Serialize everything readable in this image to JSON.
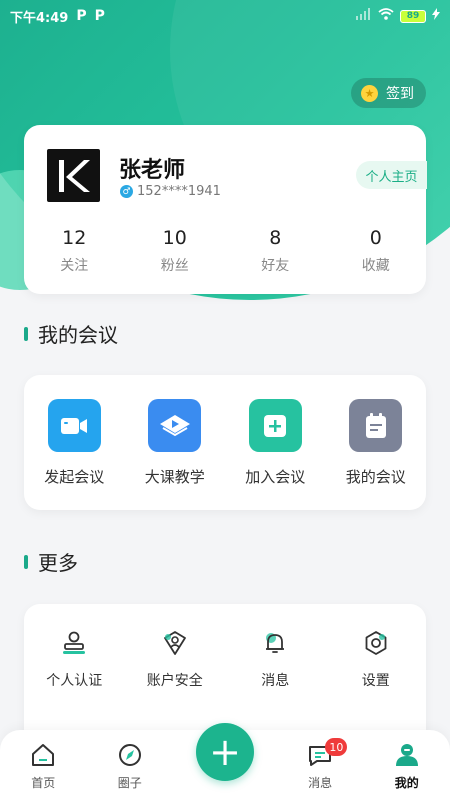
{
  "status_bar": {
    "time": "下午4:49",
    "p1": "P",
    "p2": "P",
    "battery": "89"
  },
  "checkin_label": "签到",
  "profile": {
    "name": "张老师",
    "phone": "152****1941",
    "homepage_label": "个人主页",
    "stats": [
      {
        "num": "12",
        "label": "关注"
      },
      {
        "num": "10",
        "label": "粉丝"
      },
      {
        "num": "8",
        "label": "好友"
      },
      {
        "num": "0",
        "label": "收藏"
      }
    ]
  },
  "meetings": {
    "title": "我的会议",
    "items": [
      {
        "label": "发起会议",
        "icon": "video-camera-icon",
        "color": "#25a4ee"
      },
      {
        "label": "大课教学",
        "icon": "play-lesson-icon",
        "color": "#3a8cf0"
      },
      {
        "label": "加入会议",
        "icon": "add-meeting-icon",
        "color": "#26c2a0"
      },
      {
        "label": "我的会议",
        "icon": "notepad-icon",
        "color": "#7c8398"
      }
    ]
  },
  "more": {
    "title": "更多",
    "items": [
      {
        "label": "个人认证",
        "icon": "person-verify-icon"
      },
      {
        "label": "账户安全",
        "icon": "shield-user-icon"
      },
      {
        "label": "消息",
        "icon": "bell-icon"
      },
      {
        "label": "设置",
        "icon": "gear-icon"
      }
    ]
  },
  "tabbar": {
    "items": [
      {
        "label": "首页",
        "icon": "home-icon"
      },
      {
        "label": "圈子",
        "icon": "compass-icon"
      },
      {
        "label": "消息",
        "icon": "chat-icon",
        "badge": "10"
      },
      {
        "label": "我的",
        "icon": "profile-icon"
      }
    ],
    "fab_label": "+"
  },
  "colors": {
    "primary": "#1aa98a",
    "badge": "#ef3b3b"
  }
}
